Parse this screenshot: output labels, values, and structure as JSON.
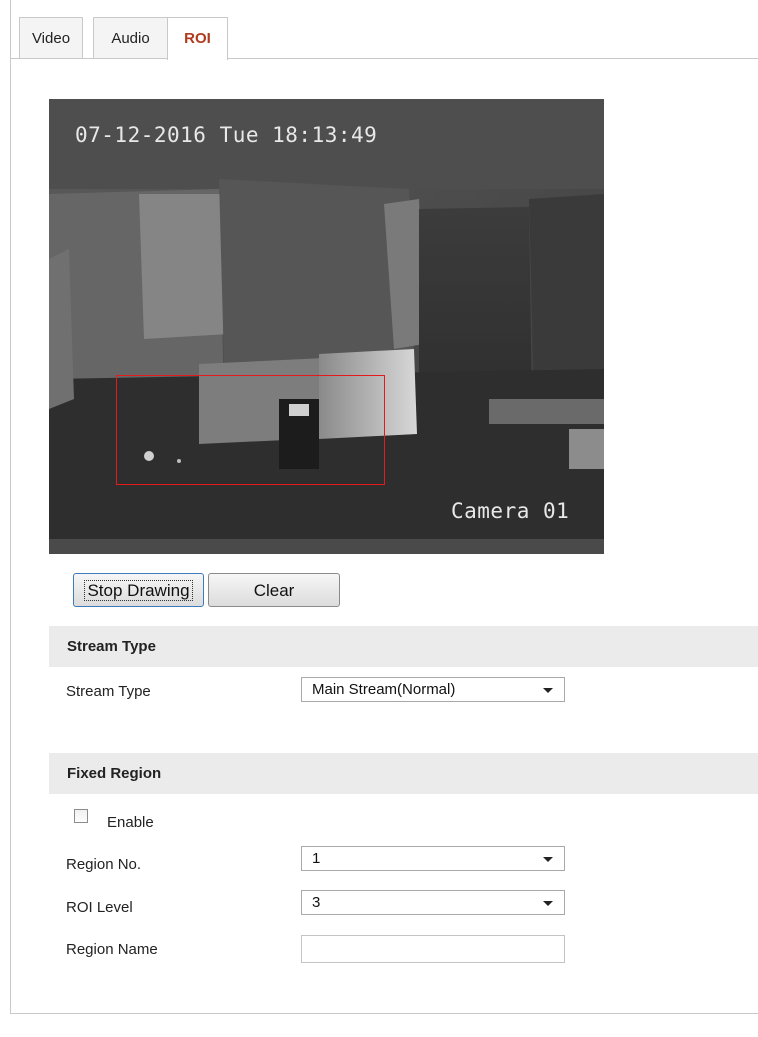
{
  "tabs": [
    {
      "label": "Video",
      "active": false
    },
    {
      "label": "Audio",
      "active": false
    },
    {
      "label": "ROI",
      "active": true
    }
  ],
  "preview": {
    "timestamp": "07-12-2016 Tue 18:13:49",
    "camera_name": "Camera 01"
  },
  "buttons": {
    "stop_drawing": "Stop Drawing",
    "clear": "Clear"
  },
  "stream_section": {
    "title": "Stream Type",
    "stream_type_label": "Stream Type",
    "stream_type_value": "Main Stream(Normal)"
  },
  "fixed_region": {
    "title": "Fixed Region",
    "enable_label": "Enable",
    "enable_checked": false,
    "region_no_label": "Region No.",
    "region_no_value": "1",
    "roi_level_label": "ROI Level",
    "roi_level_value": "3",
    "region_name_label": "Region Name",
    "region_name_value": ""
  },
  "colors": {
    "active_tab_text": "#b03a1e",
    "roi_box": "#e41b1b",
    "section_header_bg": "#ebebeb"
  }
}
